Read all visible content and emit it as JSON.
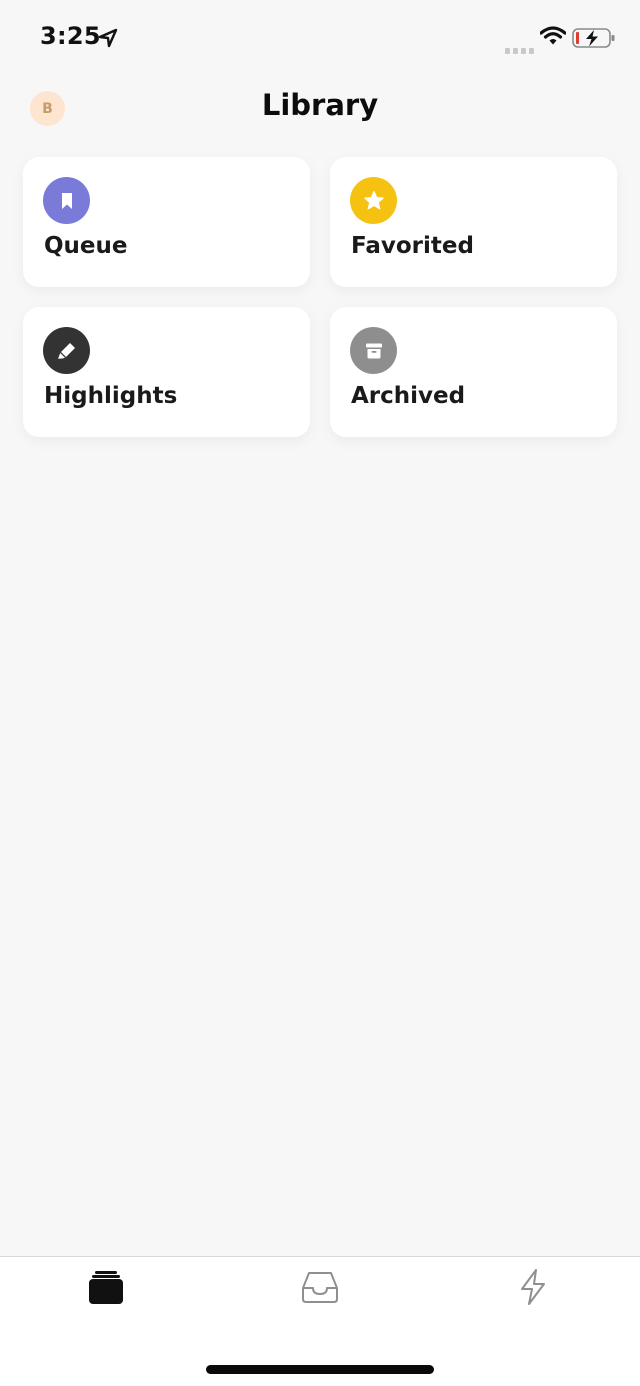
{
  "status_bar": {
    "time": "3:25",
    "icons": [
      "location-arrow-icon",
      "cellular-signal-icon",
      "wifi-icon",
      "battery-charging-icon"
    ]
  },
  "header": {
    "avatar_initial": "B",
    "title": "Library"
  },
  "cards": [
    {
      "label": "Queue",
      "icon": "bookmark-icon",
      "color": "#7a7bd8"
    },
    {
      "label": "Favorited",
      "icon": "star-icon",
      "color": "#f5c211"
    },
    {
      "label": "Highlights",
      "icon": "highlighter-icon",
      "color": "#333333"
    },
    {
      "label": "Archived",
      "icon": "archive-box-icon",
      "color": "#8e8e8e"
    }
  ],
  "tab_bar": {
    "tabs": [
      {
        "name": "library",
        "icon": "library-stack-icon",
        "active": true
      },
      {
        "name": "inbox",
        "icon": "inbox-tray-icon",
        "active": false
      },
      {
        "name": "activity",
        "icon": "lightning-bolt-icon",
        "active": false
      }
    ]
  },
  "colors": {
    "background": "#f7f7f7",
    "card": "#ffffff",
    "avatar_bg": "#fde5cf",
    "avatar_text": "#c89b6a"
  }
}
